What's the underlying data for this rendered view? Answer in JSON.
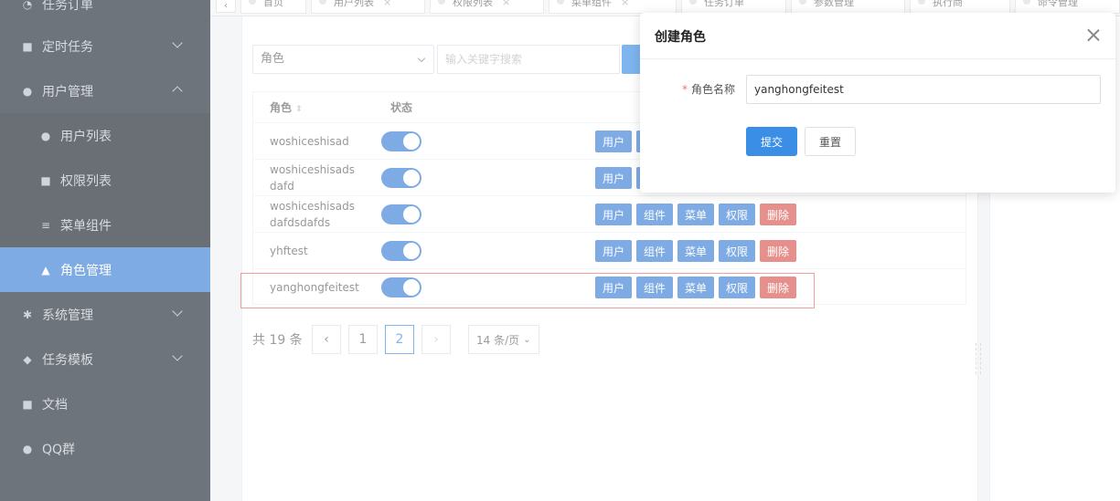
{
  "sidebar": {
    "items": [
      {
        "label": "任务订单",
        "icon": "order-icon"
      },
      {
        "label": "定时任务",
        "icon": "timer-icon"
      },
      {
        "label": "用户管理",
        "icon": "users-icon"
      },
      {
        "label": "用户列表",
        "icon": "user-list-icon"
      },
      {
        "label": "权限列表",
        "icon": "lock-icon"
      },
      {
        "label": "菜单组件",
        "icon": "menu-icon"
      },
      {
        "label": "角色管理",
        "icon": "person-icon"
      },
      {
        "label": "系统管理",
        "icon": "gear-icon"
      },
      {
        "label": "任务模板",
        "icon": "template-icon"
      },
      {
        "label": "文档",
        "icon": "book-icon"
      },
      {
        "label": "QQ群",
        "icon": "qq-icon"
      }
    ]
  },
  "tabs": [
    "首页",
    "用户列表",
    "权限列表",
    "菜单组件",
    "任务订单",
    "参数管理",
    "执行商",
    "命令管理"
  ],
  "filter": {
    "select_value": "角色",
    "search_placeholder": "输入关键字搜索"
  },
  "table": {
    "col_role": "角色",
    "col_status": "状态",
    "rows": [
      {
        "role": "woshiceshisad",
        "enabled": true
      },
      {
        "role": "woshiceshisads dafd",
        "enabled": true
      },
      {
        "role": "woshiceshisads dafdsdafds",
        "enabled": true
      },
      {
        "role": "yhftest",
        "enabled": true
      },
      {
        "role": "yanghongfeitest",
        "enabled": true
      }
    ],
    "actions": {
      "users": "用户",
      "components": "组件",
      "menu": "菜单",
      "permissions": "权限",
      "delete": "删除"
    }
  },
  "pager": {
    "total": "共 19 条",
    "pages": [
      "1",
      "2"
    ],
    "current": "2",
    "size": "14 条/页"
  },
  "dialog": {
    "title": "创建角色",
    "label": "角色名称",
    "required_mark": "*",
    "value": "yanghongfeitest",
    "submit": "提交",
    "reset": "重置"
  },
  "colors": {
    "primary": "#3a8ee6",
    "danger": "#d9534f",
    "sidebar": "#202a36"
  }
}
